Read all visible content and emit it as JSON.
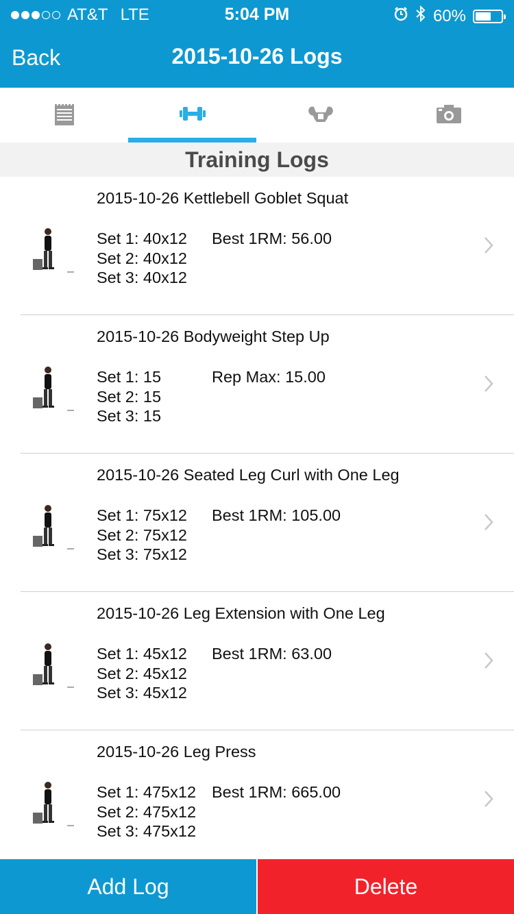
{
  "status_bar": {
    "carrier": "AT&T",
    "network": "LTE",
    "time": "5:04 PM",
    "battery_text": "60%",
    "battery_level": 0.6,
    "signal_bars_filled": 3,
    "signal_bars_total": 5
  },
  "nav": {
    "back_label": "Back",
    "title": "2015-10-26 Logs"
  },
  "tabs": [
    {
      "icon": "notepad-icon",
      "active": false
    },
    {
      "icon": "dumbbell-icon",
      "active": true
    },
    {
      "icon": "flexed-arms-icon",
      "active": false
    },
    {
      "icon": "camera-icon",
      "active": false
    }
  ],
  "section_title": "Training Logs",
  "logs": [
    {
      "title": "2015-10-26 Kettlebell Goblet Squat",
      "sets": [
        "Set 1: 40x12",
        "Set 2: 40x12",
        "Set 3: 40x12"
      ],
      "best": "Best 1RM: 56.00"
    },
    {
      "title": "2015-10-26 Bodyweight Step Up",
      "sets": [
        "Set 1: 15",
        "Set 2: 15",
        "Set 3: 15"
      ],
      "best": "Rep Max: 15.00"
    },
    {
      "title": "2015-10-26 Seated Leg Curl with One Leg",
      "sets": [
        "Set 1: 75x12",
        "Set 2: 75x12",
        "Set 3: 75x12"
      ],
      "best": "Best 1RM: 105.00"
    },
    {
      "title": "2015-10-26 Leg Extension with One Leg",
      "sets": [
        "Set 1: 45x12",
        "Set 2: 45x12",
        "Set 3: 45x12"
      ],
      "best": "Best 1RM: 63.00"
    },
    {
      "title": "2015-10-26 Leg Press",
      "sets": [
        "Set 1: 475x12",
        "Set 2: 475x12",
        "Set 3: 475x12"
      ],
      "best": "Best 1RM: 665.00"
    }
  ],
  "buttons": {
    "add_label": "Add Log",
    "delete_label": "Delete"
  },
  "colors": {
    "header": "#0e98d1",
    "tab_active": "#29aee6",
    "tab_inactive": "#999999",
    "delete": "#f2222a"
  }
}
